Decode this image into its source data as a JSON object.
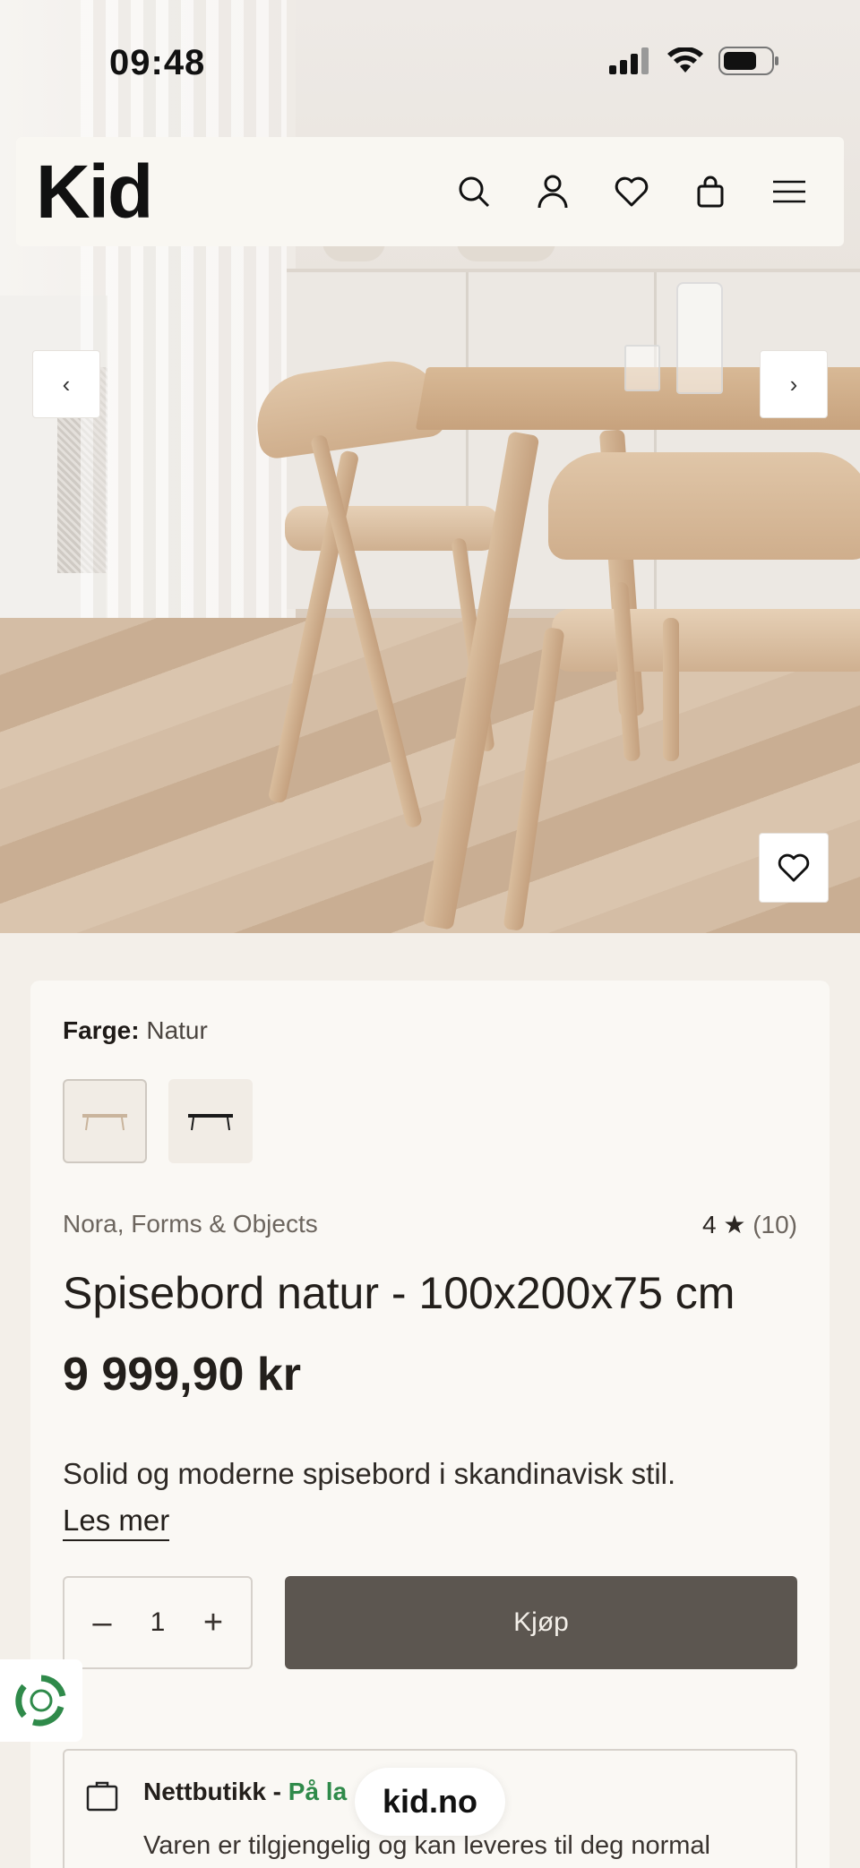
{
  "status_bar": {
    "time": "09:48"
  },
  "header": {
    "logo": "Kid",
    "icons": [
      "search-icon",
      "account-icon",
      "wishlist-icon",
      "cart-icon",
      "menu-icon"
    ]
  },
  "carousel": {
    "prev_label": "‹",
    "next_label": "›"
  },
  "product": {
    "color_label": "Farge:",
    "color_value": "Natur",
    "brand": "Nora, Forms & Objects",
    "rating_value": "4 ★",
    "rating_count": "(10)",
    "title": "Spisebord natur - 100x200x75 cm",
    "price": "9 999,90 kr",
    "description": "Solid og moderne spisebord i skandinavisk stil.",
    "read_more": "Les mer",
    "quantity": "1",
    "qty_minus": "–",
    "qty_plus": "+",
    "buy_label": "Kjøp"
  },
  "store": {
    "label": "Nettbutikk - ",
    "status": "På la",
    "text": "Varen er tilgjengelig og kan leveres til deg normal"
  },
  "browser": {
    "url": "kid.no"
  }
}
